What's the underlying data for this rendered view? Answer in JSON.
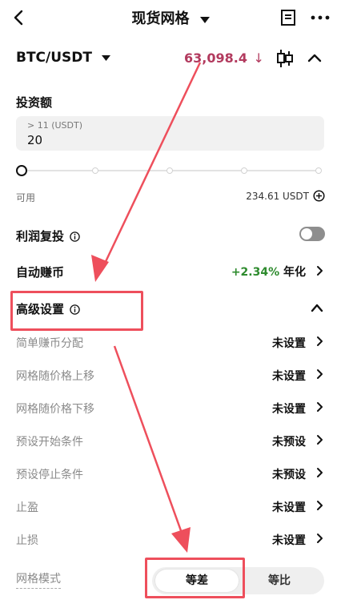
{
  "header": {
    "title": "现货网格",
    "back_icon": "chevron-left-icon",
    "caret_icon": "caret-down-icon",
    "doc_icon": "document-icon",
    "more_icon": "more-dots-icon"
  },
  "pair": {
    "name": "BTC/USDT",
    "price": "63,098.4",
    "price_arrow": "↓",
    "price_color": "#b23a5e",
    "kline_icon": "candlestick-icon",
    "collapse_icon": "chevron-up-icon"
  },
  "invest": {
    "label": "投资额",
    "placeholder": "> 11 (USDT)",
    "value": "20"
  },
  "slider": {
    "position_percent": 0,
    "stops": 5
  },
  "available": {
    "label": "可用",
    "value": "234.61 USDT",
    "plus_icon": "add-circle-icon"
  },
  "profit_reinvest": {
    "label": "利润复投",
    "enabled": false
  },
  "auto_earn": {
    "label": "自动赚币",
    "rate": "+2.34%",
    "rate_suffix": " 年化",
    "rate_color": "#2e8b2e"
  },
  "advanced": {
    "label": "高级设置",
    "expanded": true
  },
  "settings": [
    {
      "label": "简单赚币分配",
      "value": "未设置"
    },
    {
      "label": "网格随价格上移",
      "value": "未设置"
    },
    {
      "label": "网格随价格下移",
      "value": "未设置"
    },
    {
      "label": "预设开始条件",
      "value": "未预设"
    },
    {
      "label": "预设停止条件",
      "value": "未预设"
    },
    {
      "label": "止盈",
      "value": "未设置"
    },
    {
      "label": "止损",
      "value": "未设置"
    }
  ],
  "grid_mode": {
    "label": "网格模式",
    "options": [
      "等差",
      "等比"
    ],
    "selected": "等差"
  },
  "annotation": {
    "highlight_color": "#ee4f5c"
  }
}
